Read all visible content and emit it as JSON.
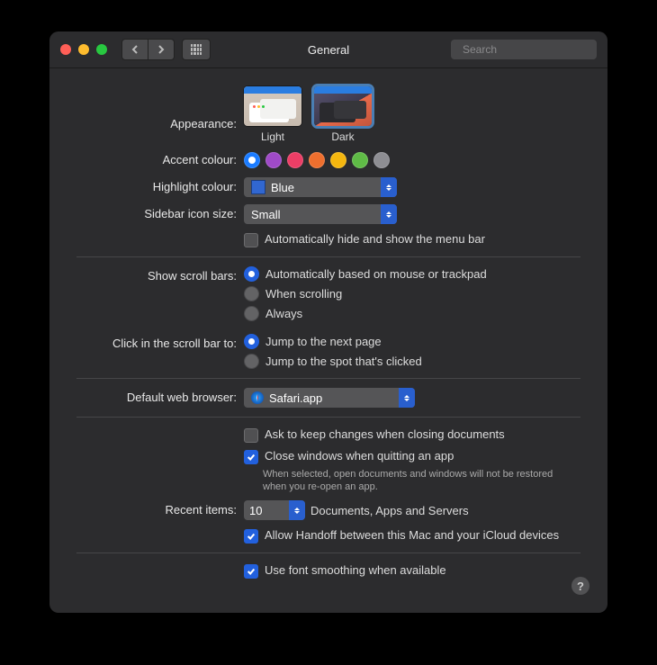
{
  "title": "General",
  "search_placeholder": "Search",
  "appearance": {
    "label": "Appearance:",
    "options": {
      "light": "Light",
      "dark": "Dark"
    },
    "selected": "dark"
  },
  "accent": {
    "label": "Accent colour:",
    "colors": [
      "#1a7bff",
      "#9f4ac7",
      "#ec3e66",
      "#ef6f2e",
      "#f5b70f",
      "#5fbb46",
      "#8e8e93"
    ],
    "selected": 0
  },
  "highlight": {
    "label": "Highlight colour:",
    "value": "Blue"
  },
  "sidebar_icon": {
    "label": "Sidebar icon size:",
    "value": "Small"
  },
  "auto_hide_menu": {
    "label": "Automatically hide and show the menu bar",
    "checked": false
  },
  "scrollbars": {
    "label": "Show scroll bars:",
    "options": [
      "Automatically based on mouse or trackpad",
      "When scrolling",
      "Always"
    ],
    "selected": 0
  },
  "scroll_click": {
    "label": "Click in the scroll bar to:",
    "options": [
      "Jump to the next page",
      "Jump to the spot that's clicked"
    ],
    "selected": 0
  },
  "browser": {
    "label": "Default web browser:",
    "value": "Safari.app"
  },
  "ask_keep": {
    "label": "Ask to keep changes when closing documents",
    "checked": false
  },
  "close_windows": {
    "label": "Close windows when quitting an app",
    "checked": true,
    "desc": "When selected, open documents and windows will not be restored when you re-open an app."
  },
  "recent": {
    "label": "Recent items:",
    "value": "10",
    "suffix": "Documents, Apps and Servers"
  },
  "handoff": {
    "label": "Allow Handoff between this Mac and your iCloud devices",
    "checked": true
  },
  "font_smoothing": {
    "label": "Use font smoothing when available",
    "checked": true
  }
}
